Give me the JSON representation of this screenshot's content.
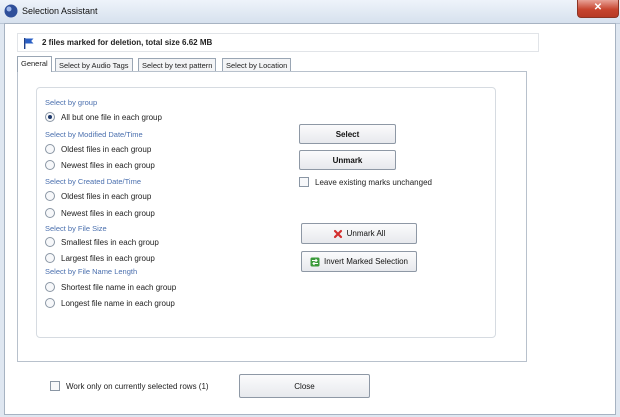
{
  "window": {
    "title": "Selection Assistant",
    "close_glyph": "✕"
  },
  "status": {
    "text": "2 files marked for deletion, total size 6.62 MB",
    "icon": "flag-icon"
  },
  "tabs": [
    {
      "label": "General",
      "active": true
    },
    {
      "label": "Select by Audio Tags",
      "active": false
    },
    {
      "label": "Select by text pattern",
      "active": false
    },
    {
      "label": "Select by Location",
      "active": false
    }
  ],
  "groups": {
    "by_group": {
      "label": "Select by group",
      "options": [
        "All but one file in each group"
      ]
    },
    "modified": {
      "label": "Select by Modified Date/Time",
      "options": [
        "Oldest files in each group",
        "Newest files in each group"
      ]
    },
    "created": {
      "label": "Select by Created Date/Time",
      "options": [
        "Oldest files in each group",
        "Newest files in each group"
      ]
    },
    "size": {
      "label": "Select by File Size",
      "options": [
        "Smallest files in each group",
        "Largest files in each group"
      ]
    },
    "name_length": {
      "label": "Select by File Name Length",
      "options": [
        "Shortest file name in each group",
        "Longest file name in each group"
      ]
    },
    "selected_option": "All but one file in each group"
  },
  "actions": {
    "select_label": "Select",
    "unmark_label": "Unmark",
    "leave_marks_label": "Leave existing marks unchanged",
    "leave_marks_checked": false,
    "unmark_all_label": "Unmark All",
    "invert_label": "Invert Marked Selection"
  },
  "footer": {
    "work_only_label": "Work only on currently selected rows (1)",
    "work_only_checked": false,
    "close_label": "Close"
  },
  "colors": {
    "section_label": "#4a6fae",
    "close_button": "#c7452f"
  }
}
